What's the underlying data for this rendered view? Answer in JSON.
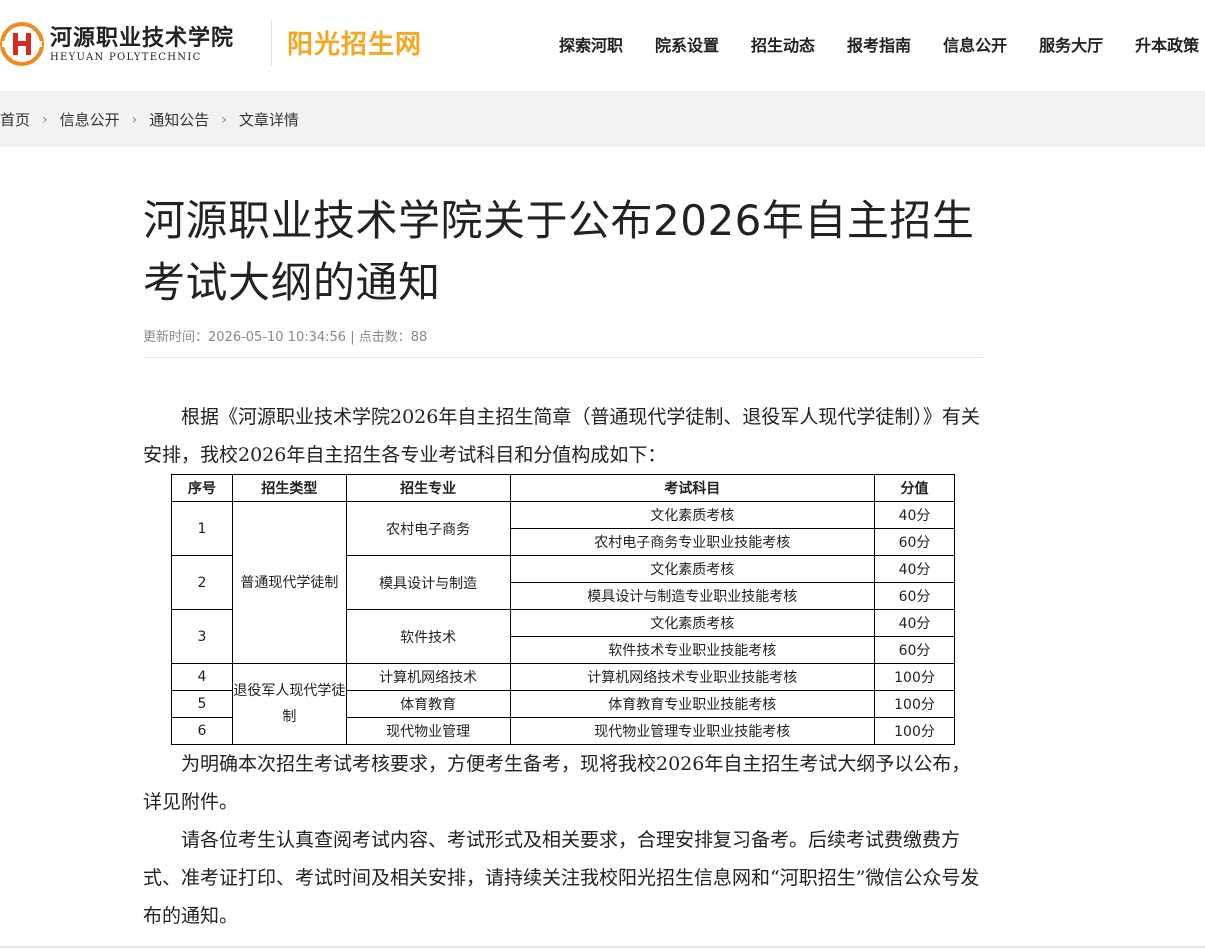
{
  "header": {
    "logo_cn": "河源职业技术学院",
    "logo_en": "HEYUAN POLYTECHNIC",
    "site_title": "阳光招生网",
    "nav": [
      "探索河职",
      "院系设置",
      "招生动态",
      "报考指南",
      "信息公开",
      "服务大厅",
      "升本政策"
    ]
  },
  "breadcrumb": [
    "首页",
    "信息公开",
    "通知公告",
    "文章详情"
  ],
  "article": {
    "title": "河源职业技术学院关于公布2026年自主招生考试大纲的通知",
    "meta": "更新时间：2026-05-10 10:34:56 | 点击数：88",
    "para1": "根据《河源职业技术学院2026年自主招生简章（普通现代学徒制、退役军人现代学徒制）》有关安排，我校2026年自主招生各专业考试科目和分值构成如下：",
    "para2": "为明确本次招生考试考核要求，方便考生备考，现将我校2026年自主招生考试大纲予以公布，详见附件。",
    "para3": "请各位考生认真查阅考试内容、考试形式及相关要求，合理安排复习备考。后续考试费缴费方式、准考证打印、考试时间及相关安排，请持续关注我校阳光招生信息网和“河职招生”微信公众号发布的通知。"
  },
  "table": {
    "headers": [
      "序号",
      "招生类型",
      "招生专业",
      "考试科目",
      "分值"
    ],
    "type_a": "普通现代学徒制",
    "type_b": "退役军人现代学徒制",
    "rows": [
      {
        "no": "1",
        "major": "农村电子商务",
        "s1": "文化素质考核",
        "v1": "40分",
        "s2": "农村电子商务专业职业技能考核",
        "v2": "60分"
      },
      {
        "no": "2",
        "major": "模具设计与制造",
        "s1": "文化素质考核",
        "v1": "40分",
        "s2": "模具设计与制造专业职业技能考核",
        "v2": "60分"
      },
      {
        "no": "3",
        "major": "软件技术",
        "s1": "文化素质考核",
        "v1": "40分",
        "s2": "软件技术专业职业技能考核",
        "v2": "60分"
      },
      {
        "no": "4",
        "major": "计算机网络技术",
        "s1": "计算机网络技术专业职业技能考核",
        "v1": "100分"
      },
      {
        "no": "5",
        "major": "体育教育",
        "s1": "体育教育专业职业技能考核",
        "v1": "100分"
      },
      {
        "no": "6",
        "major": "现代物业管理",
        "s1": "现代物业管理专业职业技能考核",
        "v1": "100分"
      }
    ]
  },
  "colors": {
    "accent": "#f5a623",
    "logo_red": "#d62b1f",
    "logo_orange": "#f08a1c"
  }
}
